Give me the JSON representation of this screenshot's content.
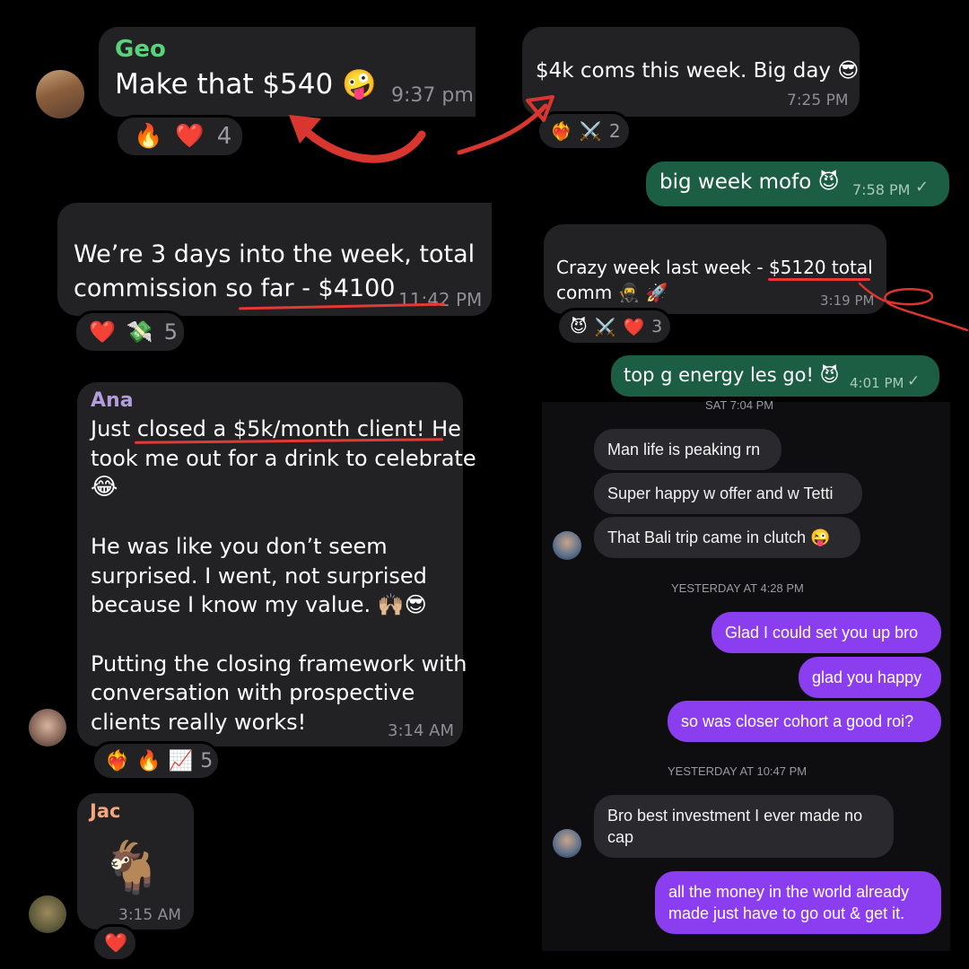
{
  "geo_msg": {
    "sender": "Geo",
    "text": "Make that $540",
    "time": "9:37 pm",
    "reaction_count": "4"
  },
  "commission_msg": {
    "text_line1": "We’re 3 days into the week, total",
    "text_line2": "commission so far - $4100",
    "time": "11:42 PM",
    "reaction_count": "5"
  },
  "ana_msg": {
    "sender": "Ana",
    "p1_l1": "Just closed a $5k/month client! He",
    "p1_l2": "took me out for a drink to celebrate",
    "p2_l1": "He was like you don’t seem",
    "p2_l2": "surprised. I went, not surprised",
    "p2_l3": "because I know my value.",
    "p3_l1": "Putting the closing framework with",
    "p3_l2": "conversation with prospective",
    "p3_l3": "clients really works!",
    "time": "3:14 AM",
    "reaction_count": "5"
  },
  "jac_msg": {
    "sender": "Jac",
    "time": "3:15 AM"
  },
  "coms_msg": {
    "text": "$4k coms this week. Big day",
    "time": "7:25 PM",
    "reaction_count": "2"
  },
  "big_week_msg": {
    "text": "big week mofo",
    "time": "7:58 PM"
  },
  "crazy_week_msg": {
    "line1": "Crazy week last week - $5120 total",
    "line2": "comm",
    "time": "3:19 PM",
    "reaction_count": "3"
  },
  "top_g_msg": {
    "text": "top g energy les go!",
    "time": "4:01 PM"
  },
  "ig_chat": {
    "top_date": "SAT 7:04 PM",
    "in_1": "Man life is peaking rn",
    "in_2": "Super happy w offer and w Tetti",
    "in_3": "That Bali trip came in clutch",
    "sep_1": "YESTERDAY AT 4:28 PM",
    "out_1": "Glad I could set you up bro",
    "out_2": "glad you happy",
    "out_3": "so was closer cohort a good roi?",
    "sep_2": "YESTERDAY AT 10:47 PM",
    "in_4_l1": "Bro best investment I ever made no",
    "in_4_l2": "cap",
    "out_4_l1": "all the money in the world already",
    "out_4_l2": "made just have to go out & get it."
  },
  "colors": {
    "whatsapp_outgoing": "#1c5e43",
    "instagram_outgoing": "#8a3ef0",
    "bubble_dark": "#222225",
    "underline_red": "#e53935",
    "geo_name": "#5ad27a",
    "ana_name": "#b39ddb",
    "jac_name": "#f4a77c"
  }
}
